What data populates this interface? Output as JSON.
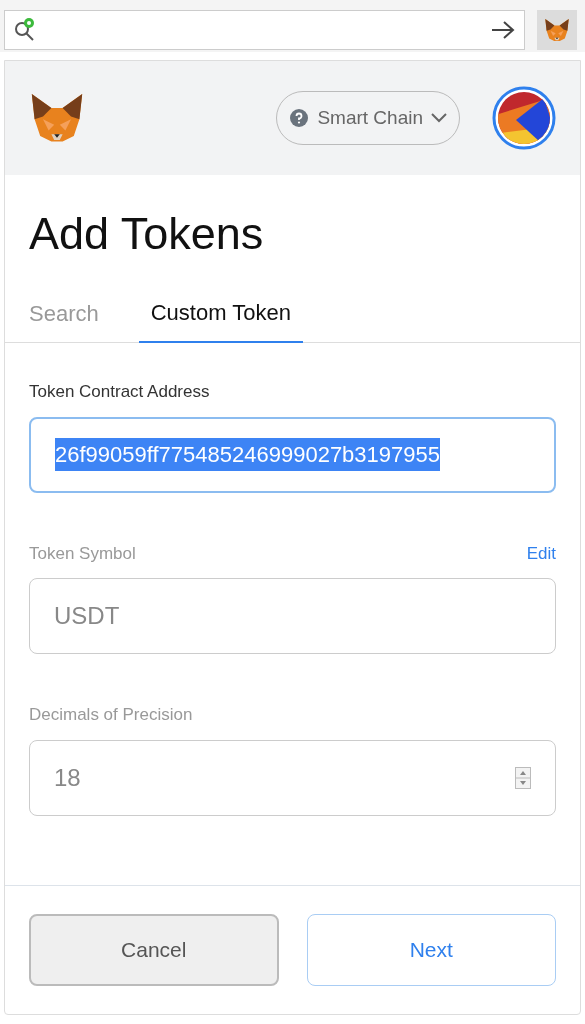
{
  "network": {
    "label": "Smart Chain"
  },
  "title": "Add Tokens",
  "tabs": [
    {
      "label": "Search",
      "selected": false
    },
    {
      "label": "Custom Token",
      "selected": true
    }
  ],
  "fields": [
    {
      "label": "Token Contract Address",
      "value": "26f99059ff775485246999027b3197955",
      "disabled": false,
      "text_selected": true,
      "kind": "text"
    },
    {
      "label": "Token Symbol",
      "value": "USDT",
      "disabled": true,
      "text_selected": false,
      "kind": "text",
      "action": "Edit"
    },
    {
      "label": "Decimals of Precision",
      "value": "18",
      "disabled": true,
      "text_selected": false,
      "kind": "number"
    }
  ],
  "buttons": [
    {
      "label": "Cancel",
      "kind": "secondary"
    },
    {
      "label": "Next",
      "kind": "primary"
    }
  ]
}
